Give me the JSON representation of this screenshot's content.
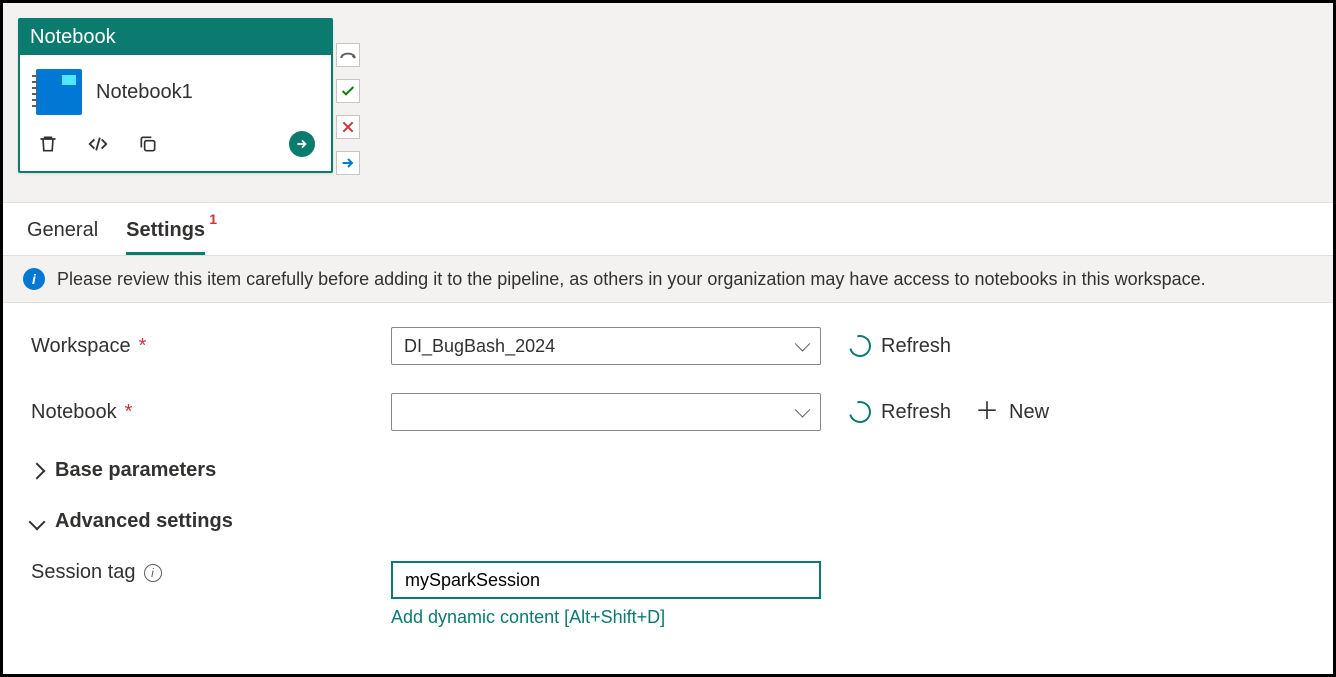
{
  "canvas": {
    "node": {
      "type_label": "Notebook",
      "title": "Notebook1"
    }
  },
  "tabs": {
    "general": "General",
    "settings": "Settings",
    "settings_badge": "1"
  },
  "banner": {
    "text": "Please review this item carefully before adding it to the pipeline, as others in your organization may have access to notebooks in this workspace."
  },
  "form": {
    "workspace": {
      "label": "Workspace",
      "value": "DI_BugBash_2024",
      "refresh": "Refresh"
    },
    "notebook": {
      "label": "Notebook",
      "value": "",
      "refresh": "Refresh",
      "new": "New"
    },
    "base_params": {
      "label": "Base parameters"
    },
    "advanced": {
      "label": "Advanced settings"
    },
    "session_tag": {
      "label": "Session tag",
      "value": "mySparkSession",
      "dynamic_link": "Add dynamic content [Alt+Shift+D]"
    }
  }
}
